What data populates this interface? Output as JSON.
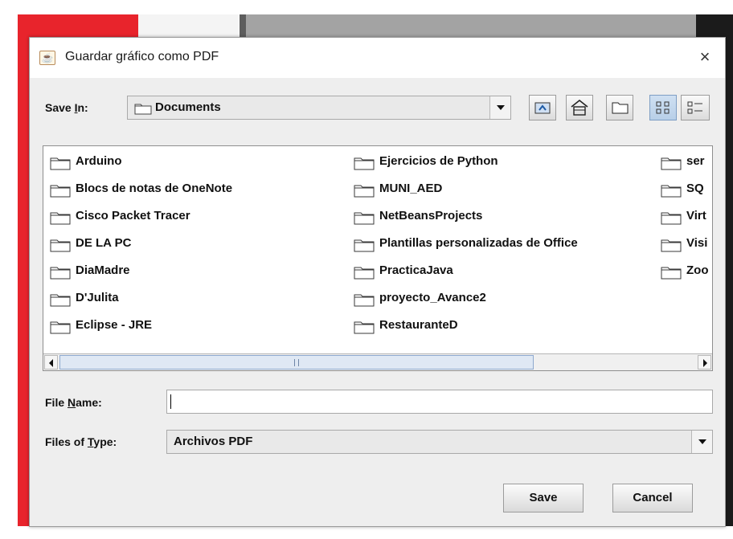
{
  "dialog": {
    "title": "Guardar gráfico como PDF",
    "close_glyph": "×",
    "icon": "java-icon"
  },
  "save_in": {
    "label_prefix": "Save ",
    "label_mnemonic": "I",
    "label_suffix": "n:",
    "value": "Documents"
  },
  "toolbar": {
    "buttons": [
      "up-one-level-icon",
      "home-icon",
      "new-folder-icon",
      "list-view-icon",
      "details-view-icon"
    ]
  },
  "files": {
    "column1": [
      "Arduino",
      "Blocs de notas de OneNote",
      "Cisco Packet Tracer",
      "DE LA PC",
      "DiaMadre",
      "D'Julita",
      "Eclipse - JRE"
    ],
    "column2": [
      "Ejercicios de Python",
      "MUNI_AED",
      "NetBeansProjects",
      "Plantillas personalizadas de Office",
      "PracticaJava",
      "proyecto_Avance2",
      "RestauranteD"
    ],
    "column3": [
      "ser",
      "SQ",
      "Virt",
      "Visi",
      "Zoo"
    ]
  },
  "file_name": {
    "label_prefix": "File ",
    "label_mnemonic": "N",
    "label_suffix": "ame:",
    "value": ""
  },
  "file_type": {
    "label_prefix": "Files of ",
    "label_mnemonic": "T",
    "label_suffix": "ype:",
    "value": "Archivos PDF"
  },
  "actions": {
    "save": "Save",
    "cancel": "Cancel"
  },
  "colors": {
    "background_red": "#e8242c",
    "dialog_bg": "#eeeeee",
    "selected_toggle": "#b8cfe8"
  }
}
